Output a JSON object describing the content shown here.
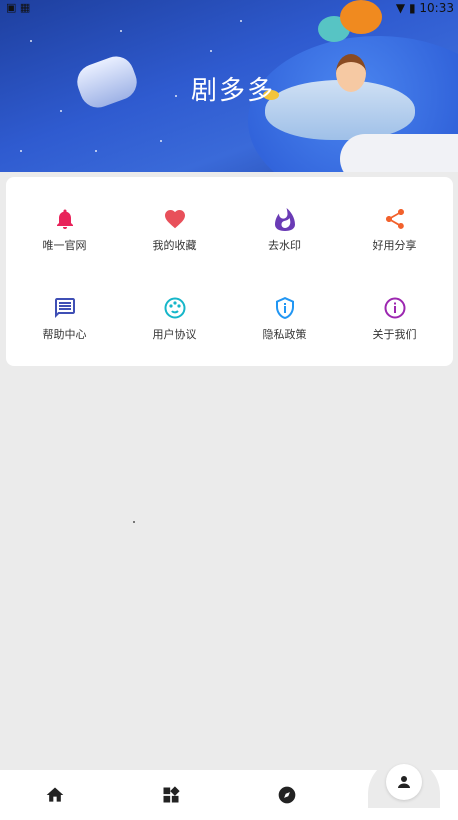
{
  "status_bar": {
    "time": "10:33"
  },
  "hero": {
    "title": "剧多多"
  },
  "menu": [
    {
      "label": "唯一官网",
      "icon": "bell-icon",
      "color": "#e8235a"
    },
    {
      "label": "我的收藏",
      "icon": "heart-icon",
      "color": "#e8505a"
    },
    {
      "label": "去水印",
      "icon": "flame-icon",
      "color": "#6a3bb5"
    },
    {
      "label": "好用分享",
      "icon": "share-icon",
      "color": "#f2612c"
    },
    {
      "label": "帮助中心",
      "icon": "message-icon",
      "color": "#3f4fb5"
    },
    {
      "label": "用户协议",
      "icon": "palette-icon",
      "color": "#16b6c9"
    },
    {
      "label": "隐私政策",
      "icon": "shield-info-icon",
      "color": "#2196f3"
    },
    {
      "label": "关于我们",
      "icon": "info-icon",
      "color": "#9c27b0"
    }
  ],
  "bottom_nav": [
    {
      "icon": "home-icon"
    },
    {
      "icon": "widgets-icon"
    },
    {
      "icon": "compass-icon"
    },
    {
      "icon": "person-icon"
    }
  ]
}
